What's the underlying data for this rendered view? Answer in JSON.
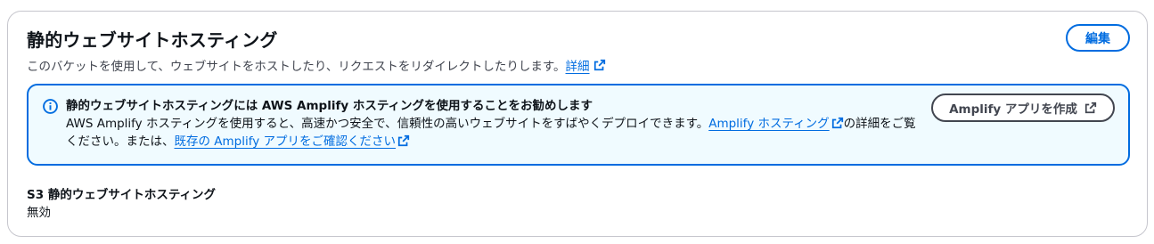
{
  "section": {
    "title": "静的ウェブサイトホスティング",
    "edit_label": "編集",
    "description": "このバケットを使用して、ウェブサイトをホストしたり、リクエストをリダイレクトしたりします。",
    "details_link": "詳細"
  },
  "alert": {
    "title": "静的ウェブサイトホスティングには AWS Amplify ホスティングを使用することをお勧めします",
    "body_part1": "AWS Amplify ホスティングを使用すると、高速かつ安全で、信頼性の高いウェブサイトをすばやくデプロイできます。",
    "amplify_hosting_link": "Amplify ホスティング",
    "body_part2": "の詳細をご覧ください。または、",
    "existing_apps_link": "既存の Amplify アプリをご確認ください",
    "create_button_label": "Amplify アプリを作成"
  },
  "status": {
    "label": "S3 静的ウェブサイトホスティング",
    "value": "無効"
  },
  "colors": {
    "accent": "#006ce0",
    "alert_background": "#f0fbff",
    "border": "#c6c6cd"
  },
  "icons": {
    "info": "info-icon",
    "external_link": "external-link-icon"
  }
}
